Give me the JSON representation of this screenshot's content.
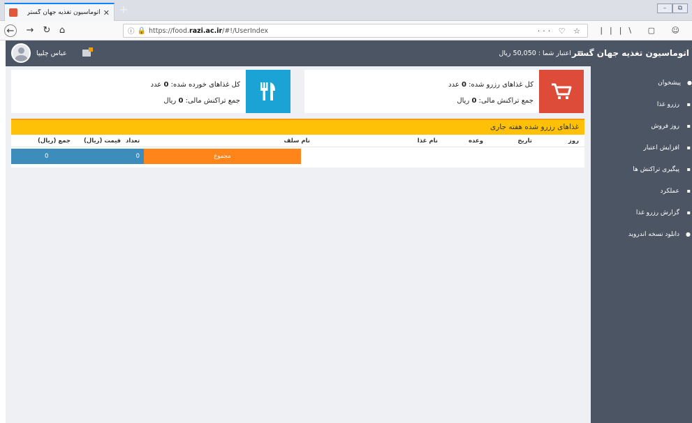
{
  "browser": {
    "tab_title": "اتوماسیون تغذیه جهان گستر",
    "tab_close": "✕",
    "new_tab": "+",
    "url_prefix": "https://food.",
    "url_domain": "razi.ac.ir",
    "url_path": "/#!/UserIndex",
    "url_actions": "··· ♡ ☆",
    "toolbar_icons": "|||\\ ▢ ☺"
  },
  "header": {
    "credit_text": "اعتبار شما : 50,050 ریال",
    "user_name": "عباس چلیپا"
  },
  "sidebar": {
    "brand": "اتوماسیون تغذیه جهان گستر",
    "items": [
      {
        "label": "پیشخوان",
        "icon": "dashboard-icon"
      },
      {
        "label": "رزرو غذا",
        "icon": "reserve-icon"
      },
      {
        "label": "روز فروش",
        "icon": "sale-icon"
      },
      {
        "label": "افزایش اعتبار",
        "icon": "credit-icon"
      },
      {
        "label": "پیگیری تراکنش ها",
        "icon": "transaction-icon"
      },
      {
        "label": "عملکرد",
        "icon": "performance-icon"
      },
      {
        "label": "گزارش رزرو غذا",
        "icon": "report-icon"
      },
      {
        "label": "دانلود نسخه اندروید",
        "icon": "android-icon"
      }
    ]
  },
  "stats": {
    "reserved": {
      "line1_prefix": "کل غذاهای رزرو شده: ",
      "line1_value": "0",
      "line1_suffix": " عدد",
      "line2_prefix": "جمع تراکنش مالی: ",
      "line2_value": "0",
      "line2_suffix": " ریال"
    },
    "eaten": {
      "line1_prefix": "کل غذاهای خورده شده: ",
      "line1_value": "0",
      "line1_suffix": " عدد",
      "line2_prefix": "جمع تراکنش مالی: ",
      "line2_value": "0",
      "line2_suffix": " ریال"
    }
  },
  "weekly_panel": {
    "title": "غذاهای رزرو شده هفته جاری",
    "columns": {
      "day": "روز",
      "date": "تاریخ",
      "meal": "وعده",
      "food": "نام غذا",
      "self": "نام سلف",
      "qty": "تعداد",
      "price": "قیمت (ریال)",
      "total": "جمع (ریال)"
    },
    "totals": {
      "label": "مجموع",
      "qty": "0",
      "total": "0"
    }
  },
  "colors": {
    "sidebar_bg": "#4b5563",
    "reserved_icon_bg": "#dd4b39",
    "eaten_icon_bg": "#1aa3d4",
    "panel_header": "#ffc107",
    "totals_orange": "#ff851b",
    "totals_blue": "#3c8dbc"
  }
}
